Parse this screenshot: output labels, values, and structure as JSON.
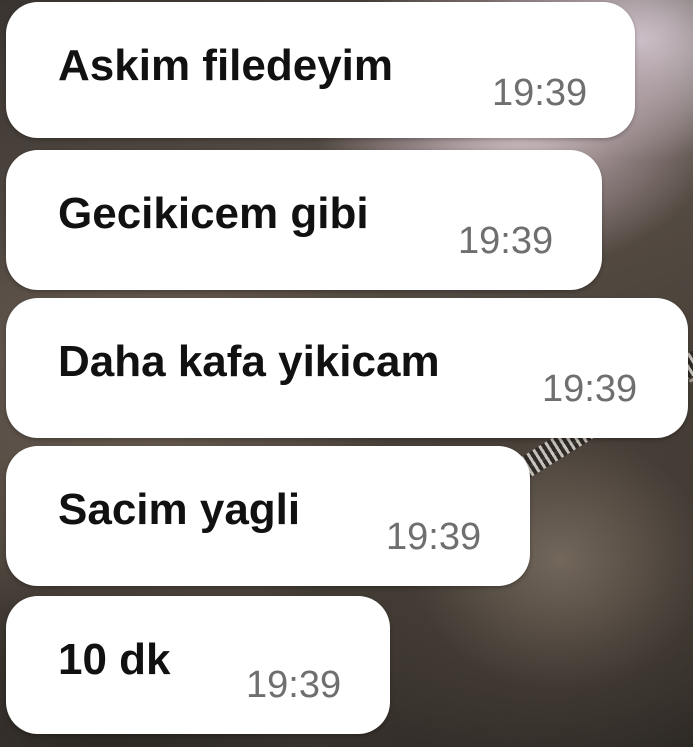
{
  "messages": [
    {
      "text": "Askim filedeyim",
      "time": "19:39"
    },
    {
      "text": "Gecikicem gibi",
      "time": "19:39"
    },
    {
      "text": "Daha kafa yikicam",
      "time": "19:39"
    },
    {
      "text": "Sacim yagli",
      "time": "19:39"
    },
    {
      "text": "10 dk",
      "time": "19:39"
    }
  ],
  "colors": {
    "bubble_background": "#ffffff",
    "message_text": "#111111",
    "timestamp_text": "#6f6f6f"
  }
}
